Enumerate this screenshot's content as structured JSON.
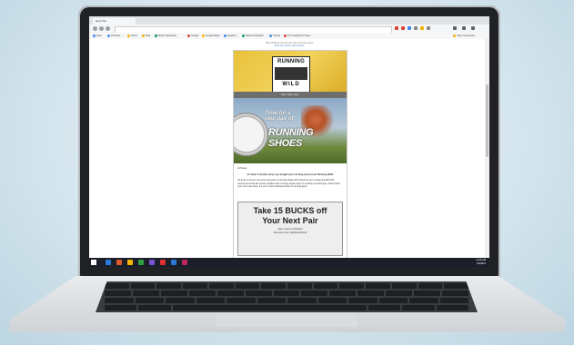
{
  "browser": {
    "tab_title": "New Tab",
    "url": "",
    "bookmarks": [
      {
        "label": "Apps",
        "color": "#4285f4"
      },
      {
        "label": "Pinterest",
        "color": "#4a90d9"
      },
      {
        "label": "NOLA",
        "color": "#f4b400"
      },
      {
        "label": "Blog",
        "color": "#f4b400"
      },
      {
        "label": "Build a Wardrobe",
        "color": "#0f9d58"
      },
      {
        "label": "Google",
        "color": "#db4437"
      },
      {
        "label": "Google Maps",
        "color": "#f4b400"
      },
      {
        "label": "Dropbox",
        "color": "#4285f4"
      },
      {
        "label": "National Weather",
        "color": "#0f9d58"
      },
      {
        "label": "Tweets",
        "color": "#4a90d9"
      },
      {
        "label": "The Heartbeat Project",
        "color": "#db4437"
      },
      {
        "label": "Other bookmarks",
        "color": "#f4b400"
      }
    ]
  },
  "email": {
    "preheader_line1": "Take 15 Bucks off your next pair of running shoes",
    "preheader_line2": "View this email in your browser",
    "logo_top": "RUNNING",
    "logo_bottom": "WILD",
    "header_bar": "Run. Shop. Live.",
    "hero_tagline_1": "Time for a",
    "hero_tagline_2": "new pair of",
    "hero_headline": "RUNNING SHOES",
    "greeting": "Hi Tessa,",
    "body_bold": "It's been 6 months since you bought your running shoes from Running Wild!",
    "body_text": "It's time to come in for your next pair of running shoes and check out our newest arrivals! We recommend that all runners replace their running shoes every 6 months to avoid injury. Show them your next new shoe. It's your most important piece of running gear!",
    "coupon_line1": "Take 15 BUCKS off",
    "coupon_line2": "Your Next Pair",
    "coupon_expire": "Offer expires 1/31/2013",
    "coupon_code": "Discount Code: NEWSHOES15"
  },
  "taskbar": {
    "time": "11:26 AM",
    "date": "1/9/2013",
    "icons": [
      "#2b78d6",
      "#e05a2b",
      "#f4b400",
      "#2f9e44",
      "#7b4fd6",
      "#e03131",
      "#2b78d6",
      "#c2255c"
    ]
  }
}
